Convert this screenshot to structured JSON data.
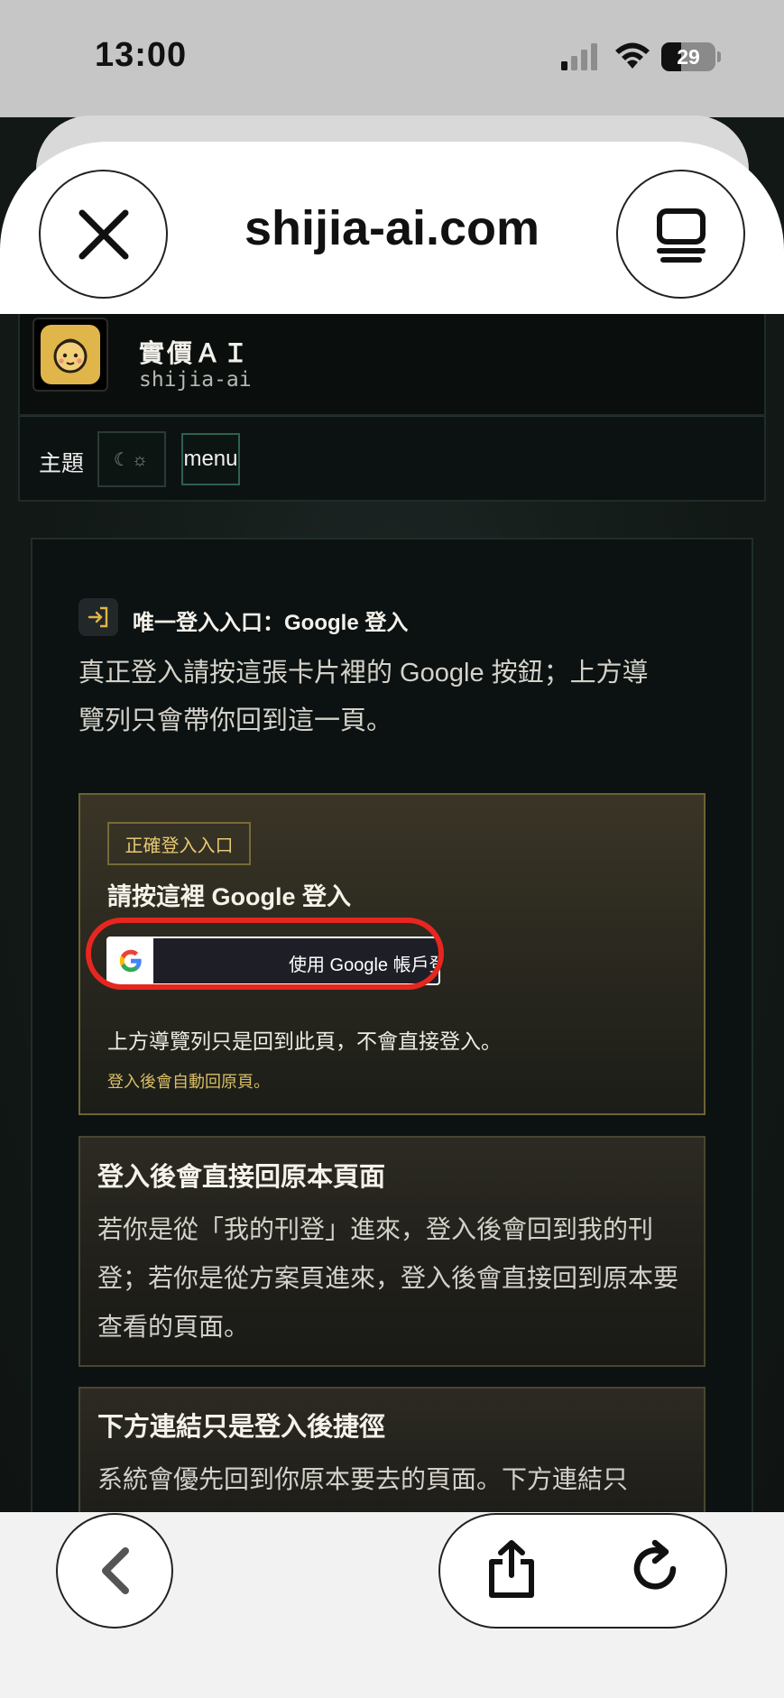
{
  "status_bar": {
    "time": "13:00",
    "battery": "29",
    "icons": [
      "signal-icon",
      "wifi-icon",
      "battery-icon"
    ]
  },
  "browser": {
    "url": "shijia-ai.com",
    "close_icon": "close-icon",
    "tabs_icon": "tabs-icon"
  },
  "site": {
    "name": "實價ＡＩ",
    "subtitle": "shijia-ai",
    "theme_label": "主題",
    "theme_toggle": "☾☼",
    "menu_label": "menu"
  },
  "login": {
    "title": "唯一登入入口：Google 登入",
    "description": "真正登入請按這張卡片裡的 Google 按鈕；上方導覽列只會帶你回到這一頁。"
  },
  "gold_card": {
    "badge": "正確登入入口",
    "heading": "請按這裡 Google 登入",
    "google_button": "使用 Google 帳戶登",
    "note": "上方導覽列只是回到此頁，不會直接登入。",
    "hint": "登入後會自動回原頁。"
  },
  "info_cards": [
    {
      "title": "登入後會直接回原本頁面",
      "body": "若你是從「我的刊登」進來，登入後會回到我的刊登；若你是從方案頁進來，登入後會直接回到原本要查看的頁面。"
    },
    {
      "title": "下方連結只是登入後捷徑",
      "body": "系統會優先回到你原本要去的頁面。下方連結只"
    }
  ],
  "toolbar": {
    "icons": [
      "back-icon",
      "share-icon",
      "reload-icon"
    ]
  },
  "colors": {
    "accent_gold": "#e6c971",
    "highlight_red": "#e6261f",
    "background": "#121816"
  }
}
